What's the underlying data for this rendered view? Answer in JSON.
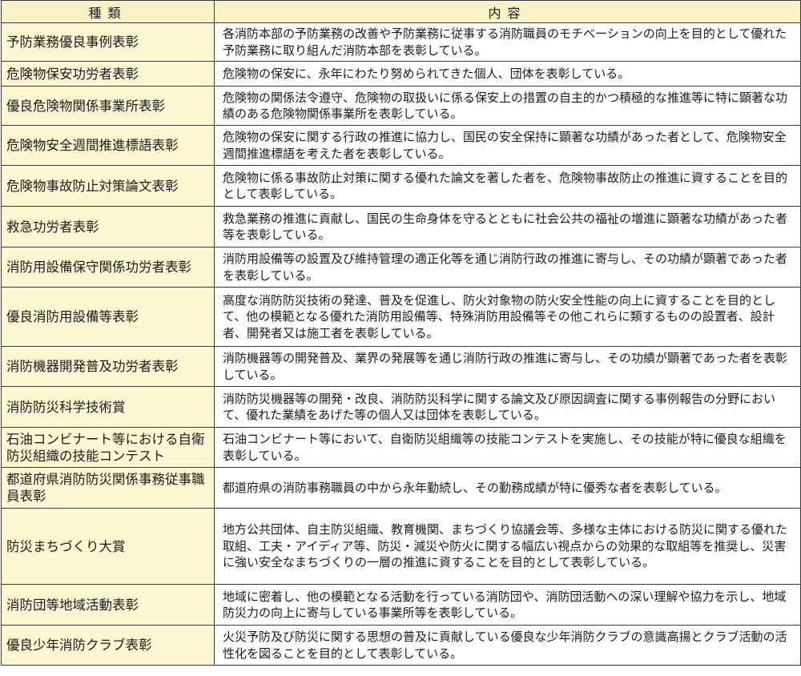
{
  "header": {
    "type_label": "種類",
    "content_label": "内容"
  },
  "rows": [
    {
      "type": "予防業務優良事例表彰",
      "content": "各消防本部の予防業務の改善や予防業務に従事する消防職員のモチベーションの向上を目的として優れた予防業務に取り組んだ消防本部を表彰している。"
    },
    {
      "type": "危険物保安功労者表彰",
      "content": "危険物の保安に、永年にわたり努められてきた個人、団体を表彰している。"
    },
    {
      "type": "優良危険物関係事業所表彰",
      "content": "危険物の関係法令遵守、危険物の取扱いに係る保安上の措置の自主的かつ積極的な推進等に特に顕著な功績のある危険物関係事業所を表彰している。"
    },
    {
      "type": "危険物安全週間推進標語表彰",
      "content": "危険物の保安に関する行政の推進に協力し、国民の安全保持に顕著な功績があった者として、危険物安全週間推進標語を考えた者を表彰している。"
    },
    {
      "type": "危険物事故防止対策論文表彰",
      "content": "危険物に係る事故防止対策に関する優れた論文を著した者を、危険物事故防止の推進に資することを目的として表彰している。"
    },
    {
      "type": "救急功労者表彰",
      "content": "救急業務の推進に貢献し、国民の生命身体を守るとともに社会公共の福祉の増進に顕著な功績があった者等を表彰している。"
    },
    {
      "type": "消防用設備保守関係功労者表彰",
      "content": "消防用設備等の設置及び維持管理の適正化等を通じ消防行政の推進に寄与し、その功績が顕著であった者を表彰している。"
    },
    {
      "type": "優良消防用設備等表彰",
      "content": "高度な消防防災技術の発達、普及を促進し、防火対象物の防火安全性能の向上に資することを目的として、他の模範となる優れた消防用設備等、特殊消防用設備等その他これらに類するものの設置者、設計者、開発者又は施工者を表彰している。"
    },
    {
      "type": "消防機器開発普及功労者表彰",
      "content": "消防機器等の開発普及、業界の発展等を通じ消防行政の推進に寄与し、その功績が顕著であった者を表彰している。"
    },
    {
      "type": "消防防災科学技術賞",
      "content": "消防防災機器等の開発・改良、消防防災科学に関する論文及び原因調査に関する事例報告の分野において、優れた業績をあげた等の個人又は団体を表彰している。"
    },
    {
      "type": "石油コンビナート等における自衛防災組織の技能コンテスト",
      "content": "石油コンビナート等において、自衛防災組織等の技能コンテストを実施し、その技能が特に優良な組織を表彰している。"
    },
    {
      "type": "都道府県消防防災関係事務従事職員表彰",
      "content": "都道府県の消防事務職員の中から永年勤続し、その勤務成績が特に優秀な者を表彰している。"
    },
    {
      "type": "防災まちづくり大賞",
      "content": "地方公共団体、自主防災組織、教育機関、まちづくり協議会等、多様な主体における防災に関する優れた取組、工夫・アイディア等、防災・減災や防火に関する幅広い視点からの効果的な取組等を推奨し、災害に強い安全なまちづくりの一層の推進に資することを目的として表彰している。"
    },
    {
      "type": "消防団等地域活動表彰",
      "content": "地域に密着し、他の模範となる活動を行っている消防団や、消防団活動への深い理解や協力を示し、地域防災力の向上に寄与している事業所等を表彰している。"
    },
    {
      "type": "優良少年消防クラブ表彰",
      "content": "火災予防及び防災に関する思想の普及に貢献している優良な少年消防クラブの意識高揚とクラブ活動の活性化を図ることを目的として表彰している。"
    }
  ]
}
